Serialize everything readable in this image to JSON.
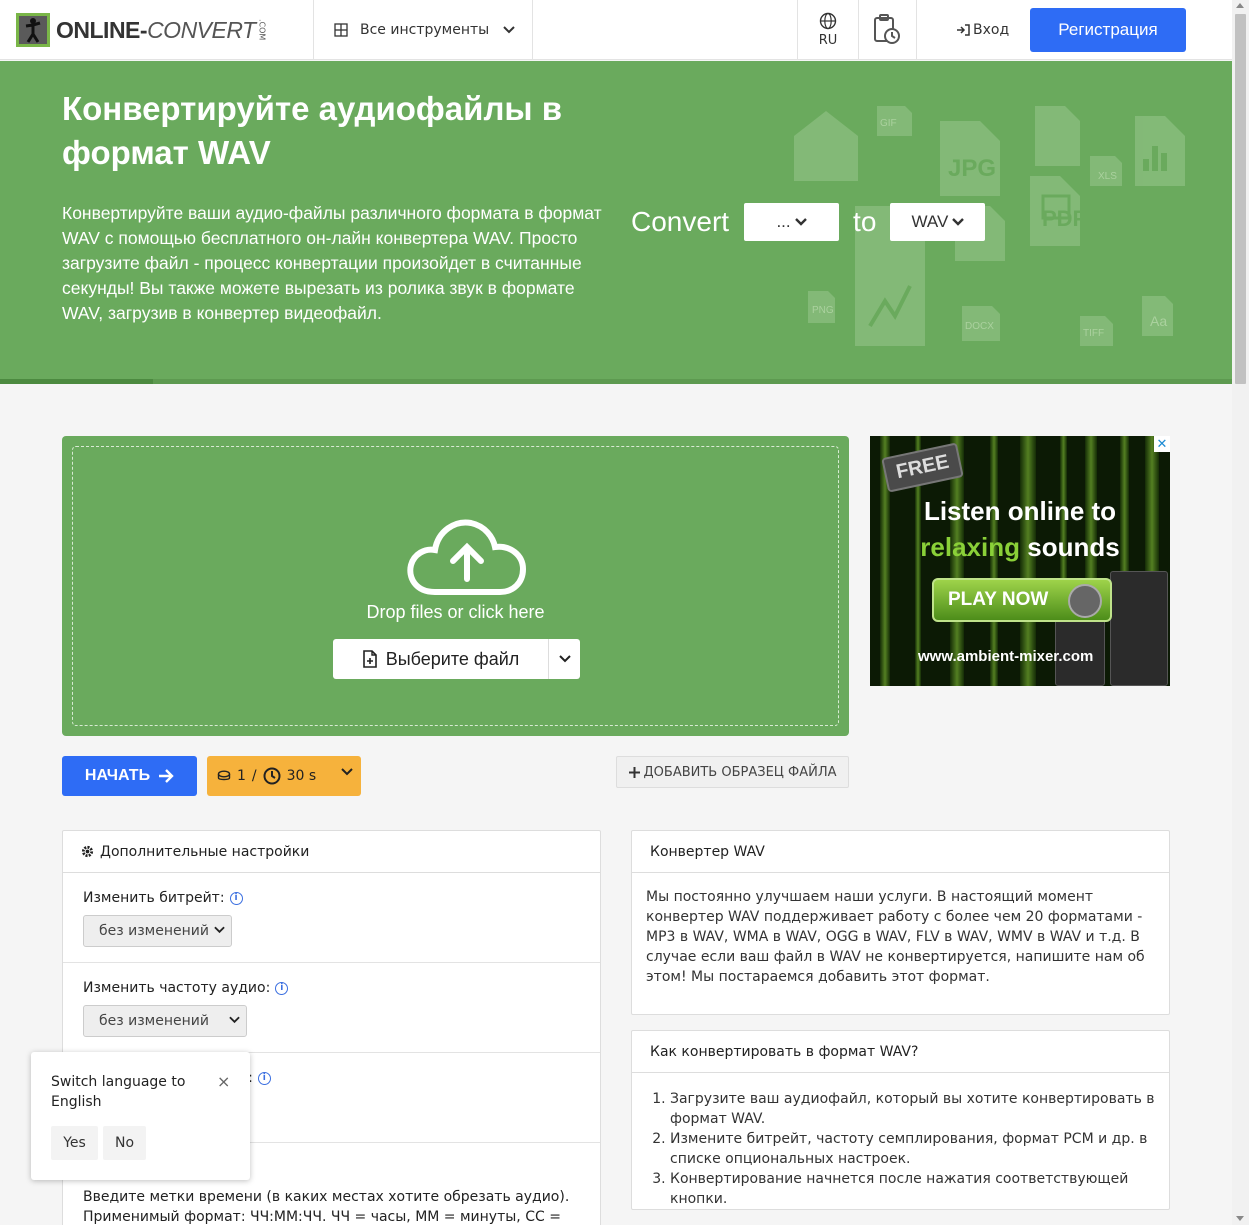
{
  "header": {
    "logo_main": "ONLINE-",
    "logo_conv": "CONVERT",
    "logo_com": ".COM",
    "tools_label": "Все инструменты",
    "lang_code": "RU",
    "login_label": "Вход",
    "register_label": "Регистрация"
  },
  "hero": {
    "title": "Конвертируйте аудиофайлы в формат WAV",
    "description": "Конвертируйте ваши аудио-файлы различного формата в формат WAV с помощью бесплатного он-лайн конвертера WAV. Просто загрузите файл - процесс конвертации произойдет в считанные секунды! Вы также можете вырезать из ролика звук в формате WAV, загрузив в конвертер видеофайл.",
    "convert_label": "Convert",
    "from_value": "...",
    "to_label": "to",
    "to_value": "WAV",
    "bg_icon_labels": [
      "GIF",
      "JPG",
      "XLS",
      "PDF",
      "PNG",
      "DOCX",
      "TIFF"
    ]
  },
  "upload": {
    "drop_text": "Drop files or click here",
    "choose_label": "Выберите файл"
  },
  "ad": {
    "close": "✕",
    "free": "FREE",
    "line1": "Listen online to",
    "line2_highlight": "relaxing",
    "line2_rest": " sounds",
    "play": "PLAY NOW",
    "url": "www.ambient-mixer.com"
  },
  "actions": {
    "start_label": "НАЧАТЬ",
    "credits_count": "1",
    "credits_sep": "/",
    "credits_time": "30 s",
    "add_sample_label": "ДОБАВИТЬ ОБРАЗЕЦ ФАЙЛА"
  },
  "settings": {
    "title": "Дополнительные настройки",
    "bitrate_label": "Изменить битрейт:",
    "bitrate_value": "без изменений",
    "frequency_label": "Изменить частоту аудио:",
    "frequency_value": "без изменений",
    "third_label_tail": "и:",
    "trim_text": "Введите метки времени (в каких местах хотите обрезать аудио). Применимый формат: ЧЧ:ММ:ЧЧ. ЧЧ = часы, ММ = минуты, СС ="
  },
  "converter_info": {
    "title": "Конвертер WAV",
    "body": "Мы постоянно улучшаем наши услуги. В настоящий момент конвертер WAV поддерживает работу с более чем 20 форматами - MP3 в WAV, WMA в WAV, OGG в WAV, FLV в WAV, WMV в WAV и т.д. В случае если ваш файл в WAV не конвертируется, напишите нам об этом! Мы постараемся добавить этот формат."
  },
  "howto": {
    "title": "Как конвертировать в формат WAV?",
    "steps": [
      "Загрузите ваш аудиофайл, который вы хотите конвертировать в формат WAV.",
      "Измените битрейт, частоту семплирования, формат PCM и др. в списке опциональных настроек.",
      "Конвертирование начнется после нажатия соответствующей кнопки."
    ]
  },
  "popup": {
    "text": "Switch language to English",
    "close": "×",
    "yes": "Yes",
    "no": "No"
  },
  "colors": {
    "brand_green": "#6aaa5d",
    "primary_blue": "#2e6cf5",
    "credits_orange": "#f6b23c"
  }
}
